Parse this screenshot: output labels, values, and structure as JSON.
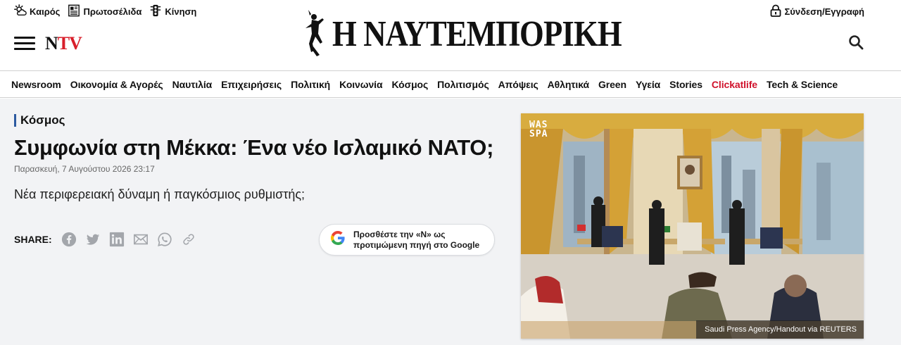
{
  "utility_links": [
    {
      "label": "Καιρός",
      "icon": "weather-icon"
    },
    {
      "label": "Πρωτοσέλιδα",
      "icon": "newspaper-icon"
    },
    {
      "label": "Κίνηση",
      "icon": "traffic-light-icon"
    }
  ],
  "login": {
    "label": "Σύνδεση/Εγγραφή",
    "icon": "lock-icon"
  },
  "brand": {
    "ntv_n": "N",
    "ntv_tv": "TV",
    "logo_text": "Η ΝΑΥΤΕΜΠΟΡΙΚΗ",
    "accent": "#d81e2a"
  },
  "nav": {
    "items": [
      "Newsroom",
      "Οικονομία & Αγορές",
      "Ναυτιλία",
      "Επιχειρήσεις",
      "Πολιτική",
      "Κοινωνία",
      "Κόσμος",
      "Πολιτισμός",
      "Απόψεις",
      "Αθλητικά",
      "Green",
      "Υγεία",
      "Stories",
      "Clickatlife",
      "Tech & Science"
    ],
    "highlight_item": "Clickatlife",
    "highlight_color": "#d0112b"
  },
  "article": {
    "category": "Κόσμος",
    "title": "Συμφωνία στη Μέκκα: Ένα νέο Ισλαμικό ΝΑΤΟ;",
    "date": "Παρασκευή, 7 Αυγούστου 2026 23:17",
    "subtitle": "Νέα περιφερειακή δύναμη ή παγκόσμιος ρυθμιστής;"
  },
  "share": {
    "label": "SHARE:",
    "buttons": [
      "facebook-icon",
      "twitter-icon",
      "linkedin-icon",
      "email-icon",
      "whatsapp-icon",
      "link-icon"
    ]
  },
  "google_cta": {
    "line1": "Προσθέστε την «Ν» ως",
    "line2": "προτιμώμενη πηγή στο Google"
  },
  "photo": {
    "badge_line1": "WAS",
    "badge_line2": "SPA",
    "caption": "Saudi Press Agency/Handout via REUTERS"
  }
}
